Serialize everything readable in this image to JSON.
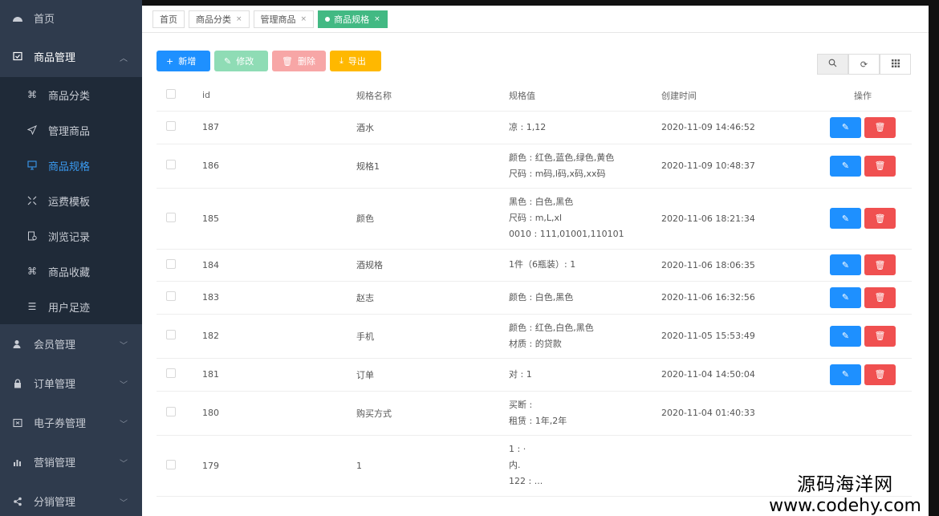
{
  "sidebar": {
    "home": "首页",
    "group_goods": "商品管理",
    "sub": [
      {
        "label": "商品分类",
        "icon": "grid-icon"
      },
      {
        "label": "管理商品",
        "icon": "send-icon"
      },
      {
        "label": "商品规格",
        "icon": "monitor-icon"
      },
      {
        "label": "运费模板",
        "icon": "shrink-icon"
      },
      {
        "label": "浏览记录",
        "icon": "doc-clock-icon"
      },
      {
        "label": "商品收藏",
        "icon": "grid-icon"
      },
      {
        "label": "用户足迹",
        "icon": "list-icon"
      }
    ],
    "groups": [
      {
        "label": "会员管理",
        "icon": "user-icon"
      },
      {
        "label": "订单管理",
        "icon": "lock-icon"
      },
      {
        "label": "电子券管理",
        "icon": "ticket-icon"
      },
      {
        "label": "营销管理",
        "icon": "chart-icon"
      },
      {
        "label": "分销管理",
        "icon": "share-icon"
      }
    ]
  },
  "tabs": [
    {
      "label": "首页"
    },
    {
      "label": "商品分类"
    },
    {
      "label": "管理商品"
    },
    {
      "label": "商品规格"
    }
  ],
  "toolbar": {
    "add": "新增",
    "edit": "修改",
    "delete": "删除",
    "export": "导出"
  },
  "table": {
    "headers": [
      "id",
      "规格名称",
      "规格值",
      "创建时间",
      "操作"
    ],
    "rows": [
      {
        "id": "187",
        "name": "酒水",
        "values": [
          "凉 : 1,12"
        ],
        "time": "2020-11-09 14:46:52"
      },
      {
        "id": "186",
        "name": "规格1",
        "values": [
          "颜色 : 红色,蓝色,绿色,黄色",
          "尺码 : m码,l码,x码,xx码"
        ],
        "time": "2020-11-09 10:48:37"
      },
      {
        "id": "185",
        "name": "颜色",
        "values": [
          "黑色 : 白色,黑色",
          "尺码 : m,L,xl",
          "0010 : 111,01001,110101"
        ],
        "time": "2020-11-06 18:21:34"
      },
      {
        "id": "184",
        "name": "酒规格",
        "values": [
          "1件（6瓶装）: 1"
        ],
        "time": "2020-11-06 18:06:35"
      },
      {
        "id": "183",
        "name": "赵志",
        "values": [
          "颜色 : 白色,黑色"
        ],
        "time": "2020-11-06 16:32:56"
      },
      {
        "id": "182",
        "name": "手机",
        "values": [
          "颜色 : 红色,白色,黑色",
          "材质 : 的贷款"
        ],
        "time": "2020-11-05 15:53:49"
      },
      {
        "id": "181",
        "name": "订单",
        "values": [
          "对 : 1"
        ],
        "time": "2020-11-04 14:50:04"
      },
      {
        "id": "180",
        "name": "购买方式",
        "values": [
          "买断 :",
          "租赁 : 1年,2年"
        ],
        "time": "2020-11-04 01:40:33"
      },
      {
        "id": "179",
        "name": "1",
        "values": [
          "1 : ·",
          "内.",
          "122 : ..."
        ],
        "time": ""
      }
    ]
  },
  "watermark": {
    "line1": "源码海洋网",
    "line2": "www.codehy.com"
  }
}
